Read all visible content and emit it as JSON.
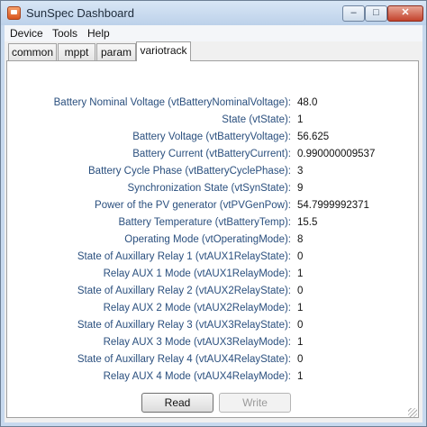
{
  "window": {
    "title": "SunSpec Dashboard",
    "controls": {
      "minimize": "–",
      "maximize": "□",
      "close": "✕"
    }
  },
  "menu": [
    "Device",
    "Tools",
    "Help"
  ],
  "tabs": [
    "common",
    "mppt",
    "param",
    "variotrack"
  ],
  "active_tab": "variotrack",
  "fields": [
    {
      "label": "Battery Nominal Voltage  (vtBatteryNominalVoltage):",
      "value": "48.0"
    },
    {
      "label": "State  (vtState):",
      "value": "1"
    },
    {
      "label": "Battery Voltage  (vtBatteryVoltage):",
      "value": "56.625"
    },
    {
      "label": "Battery Current  (vtBatteryCurrent):",
      "value": "0.990000009537"
    },
    {
      "label": "Battery Cycle Phase  (vtBatteryCyclePhase):",
      "value": "3"
    },
    {
      "label": "Synchronization State  (vtSynState):",
      "value": "9"
    },
    {
      "label": "Power of the PV generator  (vtPVGenPow):",
      "value": "54.7999992371"
    },
    {
      "label": "Battery Temperature  (vtBatteryTemp):",
      "value": "15.5"
    },
    {
      "label": "Operating Mode  (vtOperatingMode):",
      "value": "8"
    },
    {
      "label": "State of Auxillary Relay 1  (vtAUX1RelayState):",
      "value": "0"
    },
    {
      "label": "Relay AUX 1 Mode  (vtAUX1RelayMode):",
      "value": "1"
    },
    {
      "label": "State of Auxillary Relay 2  (vtAUX2RelayState):",
      "value": "0"
    },
    {
      "label": "Relay AUX 2 Mode  (vtAUX2RelayMode):",
      "value": "1"
    },
    {
      "label": "State of Auxillary Relay 3  (vtAUX3RelayState):",
      "value": "0"
    },
    {
      "label": "Relay AUX 3 Mode  (vtAUX3RelayMode):",
      "value": "1"
    },
    {
      "label": "State of Auxillary Relay 4  (vtAUX4RelayState):",
      "value": "0"
    },
    {
      "label": "Relay AUX 4 Mode  (vtAUX4RelayMode):",
      "value": "1"
    }
  ],
  "buttons": {
    "read": "Read",
    "write": "Write"
  }
}
